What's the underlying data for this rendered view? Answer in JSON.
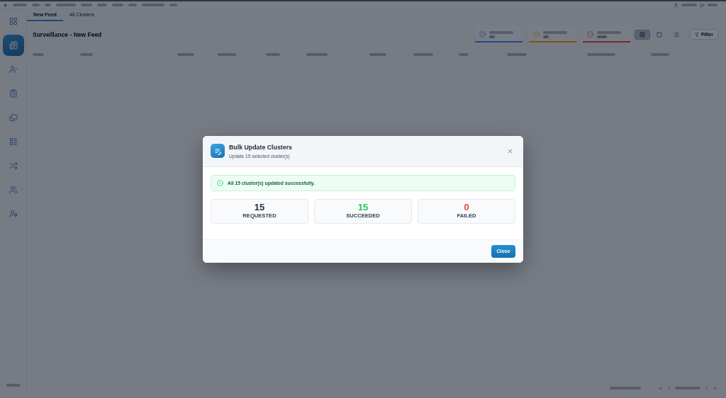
{
  "app": {
    "sidebar": {
      "items": [
        {
          "selected": false
        },
        {
          "selected": true
        },
        {
          "selected": false
        },
        {
          "selected": false
        },
        {
          "selected": false
        },
        {
          "selected": false
        },
        {
          "selected": false
        },
        {
          "selected": false
        },
        {
          "selected": false
        }
      ]
    },
    "tabs": [
      {
        "label": "New Feed",
        "selected": true
      },
      {
        "label": "All Clusters",
        "selected": false
      }
    ],
    "page_title": "Surveillance - New Feed",
    "metrics": [
      {
        "kind": "info"
      },
      {
        "kind": "warning"
      },
      {
        "kind": "alert"
      }
    ],
    "view_buttons": [
      {
        "selected": true
      },
      {
        "selected": false
      },
      {
        "selected": false
      }
    ],
    "filter_button": "Filter"
  },
  "dialog": {
    "title": "Bulk Update Clusters",
    "subtitle": "Update 15 selected cluster(s)",
    "message": "All 15 cluster(s) updated successfully.",
    "results": [
      {
        "value": "15",
        "label": "REQUESTED",
        "color": "#1e293b"
      },
      {
        "value": "15",
        "label": "SUCCEEDED",
        "color": "#22c55e"
      },
      {
        "value": "0",
        "label": "FAILED",
        "color": "#ef4444"
      }
    ],
    "close_button": "Close"
  }
}
